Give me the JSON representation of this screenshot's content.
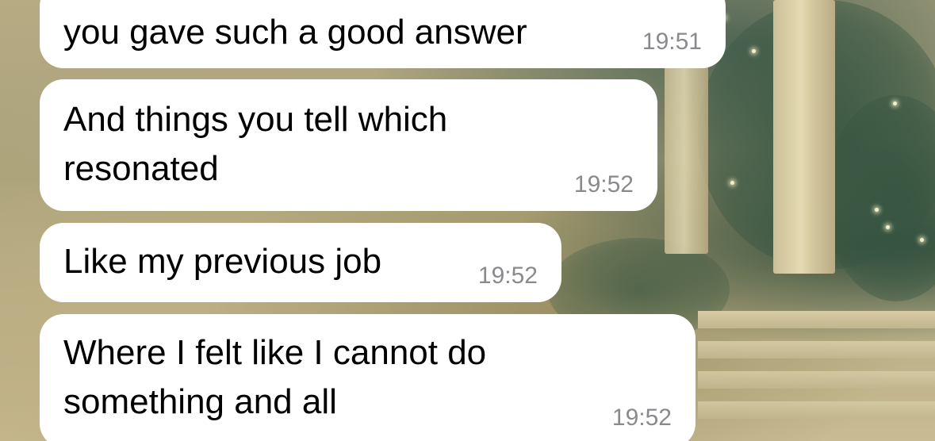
{
  "messages": [
    {
      "text": "you gave such a good answer",
      "time": "19:51"
    },
    {
      "text_lines": [
        "And things you tell which",
        "resonated"
      ],
      "time": "19:52"
    },
    {
      "text": "Like my previous job",
      "time": "19:52"
    },
    {
      "text_lines": [
        "Where I felt like I cannot do",
        "something and all"
      ],
      "time": "19:52"
    }
  ],
  "colors": {
    "bubble": "#ffffff",
    "text": "#000000",
    "timestamp": "#8a8a8e"
  }
}
